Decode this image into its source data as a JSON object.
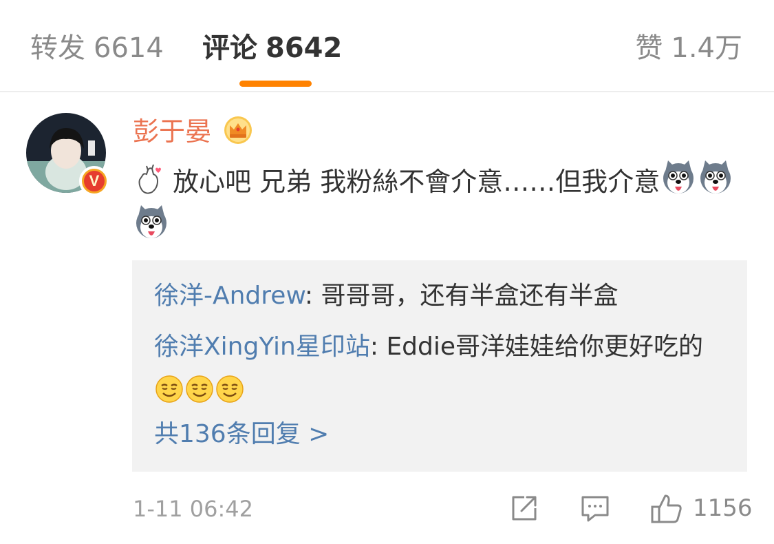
{
  "tabs": {
    "repost": {
      "label": "转发",
      "count": "6614"
    },
    "comment": {
      "label": "评论",
      "count": "8642"
    },
    "like": {
      "label": "赞",
      "count": "1.4万"
    }
  },
  "comment": {
    "username": "彭于晏",
    "text_before_emoji": "放心吧 兄弟 我粉絲不會介意……但我介意",
    "leading_emoji": "finger-heart-emoji",
    "trailing_emojis": [
      "husky-dog-emoji",
      "husky-dog-emoji",
      "husky-dog-emoji"
    ],
    "verified_badge": "V",
    "timestamp": "1-11 06:42",
    "like_count": "1156"
  },
  "replies": [
    {
      "author": "徐洋-Andrew",
      "separator": ": ",
      "text": "哥哥哥，还有半盒还有半盒"
    },
    {
      "author": "徐洋XingYin星印站",
      "separator": ": ",
      "text": "Eddie哥洋娃娃给你更好吃的",
      "emojis": [
        "smirk-face-emoji",
        "smirk-face-emoji",
        "smirk-face-emoji"
      ]
    }
  ],
  "more_replies": "共136条回复 >",
  "colors": {
    "accent_orange": "#ff8200",
    "username_orange": "#eb7350",
    "link_blue": "#507daf",
    "reply_bg": "#f2f2f2"
  }
}
